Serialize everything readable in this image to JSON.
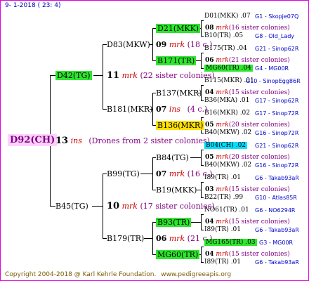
{
  "header": {
    "date": "9- 1-2018 ( 23: 4)"
  },
  "footer": {
    "copyright": "Copyright 2004-2018 @ Karl Kehrle Foundation.",
    "site": "www.pedigreeapis.org"
  },
  "root": {
    "name": "D92(CH)",
    "num": "13",
    "ins": "ins",
    "desc": "(Drones from 2 sister colonies)"
  },
  "gen1": [
    {
      "name": "D42(TG)",
      "num": "11",
      "mrk": "mrk",
      "desc": "(22 sister colonies)"
    },
    {
      "name": "B45(TG)",
      "num": "10",
      "mrk": "mrk",
      "desc": "(17 sister colonies)"
    }
  ],
  "gen2": [
    {
      "name": "D83(MKW)",
      "num": "09",
      "mrk": "mrk",
      "desc": "(18 c.)"
    },
    {
      "name": "B181(MKR)",
      "num": "07",
      "mrk": "ins",
      "desc": "(4 c.)"
    },
    {
      "name": "B99(TG)",
      "num": "07",
      "mrk": "mrk",
      "desc": "(16 c.)"
    },
    {
      "name": "B179(TR)",
      "num": "06",
      "mrk": "mrk",
      "desc": "(21 c.)"
    }
  ],
  "gen3": [
    {
      "name": "D21(MKK)",
      "num": "08",
      "mrk": "mrk",
      "desc": "(16 sister colonies)"
    },
    {
      "name": "B171(TR)",
      "num": "06",
      "mrk": "mrk",
      "desc": "(21 sister colonies)"
    },
    {
      "name": "B137(MKR)",
      "num": "04",
      "mrk": "mrk",
      "desc": "(15 sister colonies)"
    },
    {
      "name": "B136(MKR)",
      "num": "05",
      "mrk": "mrk",
      "desc": "(20 sister colonies)"
    },
    {
      "name": "B84(TG)",
      "num": "05",
      "mrk": "mrk",
      "desc": "(20 sister colonies)"
    },
    {
      "name": "B19(MKK)",
      "num": "03",
      "mrk": "mrk",
      "desc": "(15 sister colonies)"
    },
    {
      "name": "B93(TR)",
      "num": "04",
      "mrk": "mrk",
      "desc": "(15 sister colonies)"
    },
    {
      "name": "MG60(TR)",
      "num": "04",
      "mrk": "mrk",
      "desc": "(15 sister colonies)"
    }
  ],
  "gen4": [
    {
      "name": "D01(MKK)",
      "yr": ".07",
      "code": "G1 - Skopje07Q"
    },
    {
      "name": "B10(TR)",
      "yr": ".05",
      "code": "G8 - Old_Lady"
    },
    {
      "name": "B175(TR)",
      "yr": ".04",
      "code": "G21 - Sinop62R"
    },
    {
      "name": "MG60(TR)",
      "yr": ".04",
      "code": "G4 - MG00R"
    },
    {
      "name": "B115(MKR)",
      "yr": ".01",
      "code": "G10 - SinopEgg86R"
    },
    {
      "name": "B36(MKA)",
      "yr": ".01",
      "code": "G17 - Sinop62R"
    },
    {
      "name": "B16(MKR)",
      "yr": ".02",
      "code": "G17 - Sinop72R"
    },
    {
      "name": "B40(MKW)",
      "yr": ".02",
      "code": "G16 - Sinop72R"
    },
    {
      "name": "B04(CH)",
      "yr": ".02",
      "code": "G21 - Sinop62R"
    },
    {
      "name": "B40(MKW)",
      "yr": ".02",
      "code": "G16 - Sinop72R"
    },
    {
      "name": "I89(TR)",
      "yr": ".01",
      "code": "G6 - Takab93aR"
    },
    {
      "name": "B22(TR)",
      "yr": ".99",
      "code": "G10 - Atlas85R"
    },
    {
      "name": "NO61(TR)",
      "yr": ".01",
      "code": "G6 - NO6294R"
    },
    {
      "name": "I89(TR)",
      "yr": ".01",
      "code": "G6 - Takab93aR"
    },
    {
      "name": "MG165(TR)",
      "yr": ".03",
      "code": "G3 - MG00R"
    },
    {
      "name": "I89(TR)",
      "yr": ".01",
      "code": "G6 - Takab93aR"
    }
  ],
  "colors": {
    "green": "#2ee62e",
    "yellow": "#ffe000",
    "cyan": "#00e0ff",
    "root_bg": "#ffd0ff",
    "border": "#e000e0"
  }
}
